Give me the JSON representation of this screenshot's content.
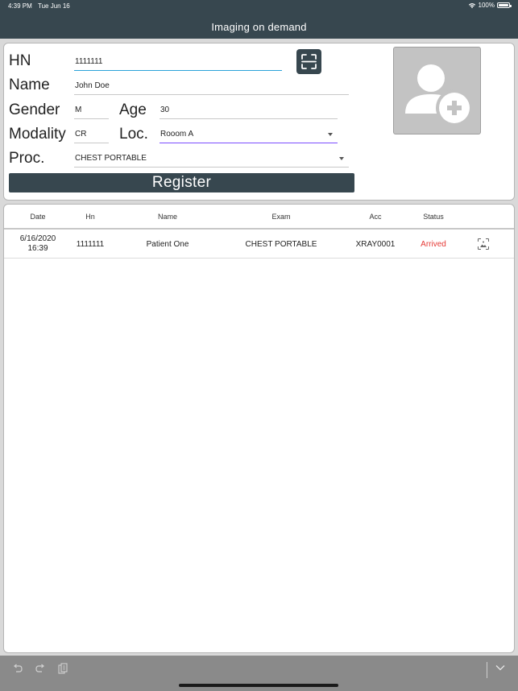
{
  "status_bar": {
    "time": "4:39 PM",
    "date": "Tue Jun 16",
    "battery": "100%"
  },
  "app": {
    "title": "Imaging on demand"
  },
  "form": {
    "hn": {
      "label": "HN",
      "value": "1111111"
    },
    "name": {
      "label": "Name",
      "value": "John Doe"
    },
    "gender": {
      "label": "Gender",
      "value": "M"
    },
    "age": {
      "label": "Age",
      "value": "30"
    },
    "modality": {
      "label": "Modality",
      "value": "CR"
    },
    "location": {
      "label": "Loc.",
      "value": "Rooom A"
    },
    "procedure": {
      "label": "Proc.",
      "value": "CHEST PORTABLE"
    },
    "register_label": "Register"
  },
  "table": {
    "headers": {
      "date": "Date",
      "hn": "Hn",
      "name": "Name",
      "exam": "Exam",
      "acc": "Acc",
      "status": "Status"
    },
    "rows": [
      {
        "date": "6/16/2020",
        "time": "16:39",
        "hn": "1111111",
        "name": "Patient One",
        "exam": "CHEST PORTABLE",
        "acc": "XRAY0001",
        "status": "Arrived"
      }
    ]
  },
  "colors": {
    "primary": "#37474f",
    "status_arrived": "#e53935",
    "focus_underline": "#2aa2d9",
    "select_underline": "#7c4dff"
  },
  "icons": [
    "wifi-icon",
    "battery-icon",
    "scan-icon",
    "add-person-icon",
    "image-icon",
    "undo-icon",
    "redo-icon",
    "paste-icon",
    "chevron-down-icon"
  ]
}
